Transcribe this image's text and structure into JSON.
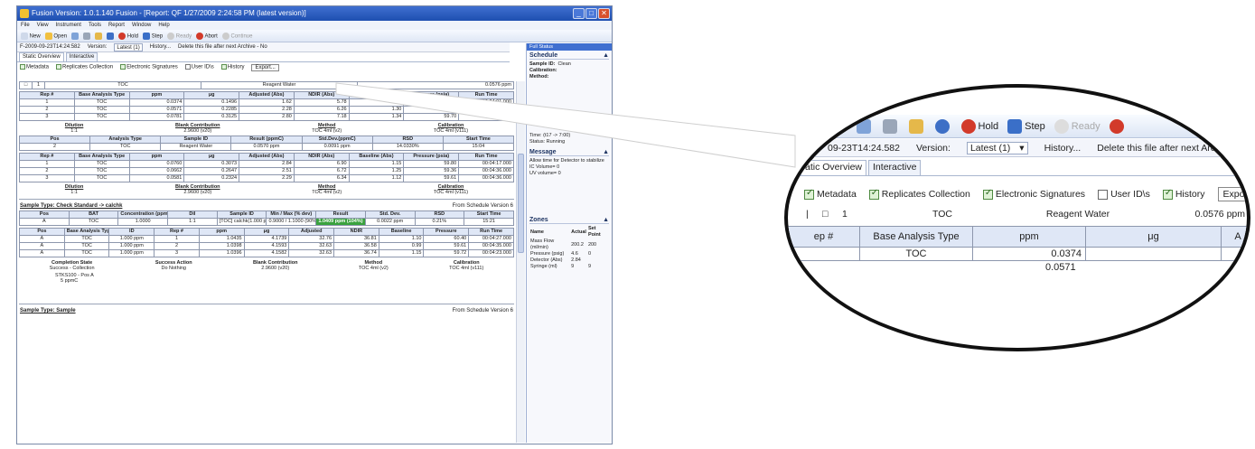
{
  "window": {
    "title": "Fusion Version: 1.0.1.140 Fusion - [Report: QF 1/27/2009 2:24:58 PM (latest version)]",
    "menu": [
      "File",
      "View",
      "Instrument",
      "Tools",
      "Report",
      "Window",
      "Help"
    ],
    "toolbar": {
      "new": "New",
      "open": "Open",
      "hold": "Hold",
      "step": "Step",
      "ready": "Ready",
      "abort": "Abort",
      "continue": "Continue"
    },
    "version_bar": {
      "report_id": "F-2009-09-23T14:24:582",
      "version_label": "Version:",
      "version_value": "Latest (1)",
      "history": "History...",
      "note": "Delete this file after next Archive - No"
    },
    "tabs": [
      "Static Overview",
      "Interactive"
    ],
    "options": [
      "Metadata",
      "Replicates Collection",
      "Electronic Signatures",
      "User ID\\s",
      "History"
    ],
    "export": "Export...",
    "top_row": {
      "num": "1",
      "type": "TOC",
      "sample": "Reagent Water",
      "result": "0.0576 ppm"
    }
  },
  "sample1": {
    "rep_headers": [
      "Rep #",
      "Base Analysis Type",
      "ppm",
      "μg",
      "Adjusted (Abs)",
      "NDIR (Abs)",
      "Baseline (Abs)",
      "Pressure (psia)",
      "Run Time"
    ],
    "rep_rows": [
      [
        "1",
        "TOC",
        "0.0374",
        "0.1496",
        "1.62",
        "5.78",
        "1.20",
        "59.20",
        "00:04:01.000"
      ],
      [
        "2",
        "TOC",
        "0.0571",
        "0.2285",
        "2.28",
        "6.26",
        "1.30",
        "59.64",
        "00:04:02.000"
      ],
      [
        "3",
        "TOC",
        "0.0781",
        "0.3125",
        "2.80",
        "7.18",
        "1.34",
        "59.70",
        "00:04:02.750"
      ]
    ],
    "stats": [
      {
        "label": "Dilution",
        "value": "1:1"
      },
      {
        "label": "Blank Contribution",
        "value": "2.9600 (v20)"
      },
      {
        "label": "Method",
        "value": "TOC 4ml (v2)"
      },
      {
        "label": "Calibration",
        "value": "TOC 4ml (v111)"
      }
    ]
  },
  "sample2": {
    "pos_headers": [
      "Pos",
      "Analysis Type",
      "Sample ID",
      "Result (ppmC)",
      "Std.Dev.(ppmC)",
      "RSD",
      "Start Time"
    ],
    "pos_row": [
      "2",
      "TOC",
      "Reagent Water",
      "0.0570 ppm",
      "0.0091 ppm",
      "14.0330%",
      "15:04"
    ],
    "rep_headers": [
      "Rep #",
      "Base Analysis Type",
      "ppm",
      "μg",
      "Adjusted (Abs)",
      "NDIR (Abs)",
      "Baseline (Abs)",
      "Pressure (psia)",
      "Run Time"
    ],
    "rep_rows": [
      [
        "1",
        "TOC",
        "0.0760",
        "0.3073",
        "2.84",
        "6.90",
        "1.15",
        "59.80",
        "00:04:17.000"
      ],
      [
        "2",
        "TOC",
        "0.0662",
        "0.2647",
        "2.51",
        "6.72",
        "1.25",
        "59.36",
        "00:04:36.000"
      ],
      [
        "3",
        "TOC",
        "0.0581",
        "0.2324",
        "2.29",
        "6.34",
        "1.12",
        "59.61",
        "00:04:36.000"
      ]
    ],
    "stats": [
      {
        "label": "Dilution",
        "value": "1:1"
      },
      {
        "label": "Blank Contribution",
        "value": "2.9600 (v20)"
      },
      {
        "label": "Method",
        "value": "TOC 4ml (v2)"
      },
      {
        "label": "Calibration",
        "value": "TOC 4ml (v111)"
      }
    ]
  },
  "check": {
    "sample_type": "Sample Type: Check Standard -> calchk",
    "schedule": "From Schedule Version 6",
    "headers": [
      "Pos",
      "BAT",
      "Concentration (ppm)",
      "Dil",
      "Sample ID",
      "Min / Max (% dev)",
      "Result",
      "Std. Dev.",
      "RSD",
      "Start Time"
    ],
    "row": [
      "A",
      "TOC",
      "1.0000",
      "1:1",
      "[TOC] calchk(1.000 ppm)",
      "0.9000 / 1.1000 (90%/110%)",
      "1.0409 ppm (104%)",
      "0.0022 ppm",
      "0.21%",
      "15:21"
    ],
    "rep_headers": [
      "Pos",
      "Base Analysis Type",
      "ID",
      "Rep #",
      "ppm",
      "μg",
      "Adjusted",
      "NDIR",
      "Baseline",
      "Pressure",
      "Run Time"
    ],
    "rep_rows": [
      [
        "A",
        "TOC",
        "1.000 ppm",
        "1",
        "1.0435",
        "4.1739",
        "32.76",
        "36.81",
        "1.10",
        "60.40",
        "00:04:27.000"
      ],
      [
        "A",
        "TOC",
        "1.000 ppm",
        "2",
        "1.0398",
        "4.1593",
        "32.63",
        "36.58",
        "0.99",
        "59.61",
        "00:04:35.000"
      ],
      [
        "A",
        "TOC",
        "1.000 ppm",
        "3",
        "1.0396",
        "4.1582",
        "32.63",
        "36.74",
        "1.15",
        "59.72",
        "00:04:23.000"
      ]
    ],
    "completion": [
      {
        "label": "Completion State",
        "value": "Success - Collection"
      },
      {
        "label": "Success Action",
        "value": "Do Nothing"
      },
      {
        "label": "Blank Contribution",
        "value": "2.9600 (v20)"
      },
      {
        "label": "Method",
        "value": "TOC 4ml (v2)"
      },
      {
        "label": "Calibration",
        "value": "TOC 4ml (v111)"
      }
    ],
    "status_line1": "STKS100 - Pos A",
    "status_line2": "5 ppmC",
    "footer_type": "Sample Type: Sample",
    "footer_schedule": "From Schedule Version 6"
  },
  "panel": {
    "head": "Full Status",
    "schedule_title": "Schedule",
    "schedule": [
      {
        "k": "Sample ID:",
        "v": "Clean"
      },
      {
        "k": "Calibration:",
        "v": ""
      },
      {
        "k": "Method:",
        "v": ""
      }
    ],
    "time": "Time: (t17 -> 7:00)",
    "status": "Status: Running",
    "message_title": "Message",
    "message": [
      "Allow time for Detector to stabilize",
      "IC Volume= 0",
      "UV volume= 0"
    ],
    "zones_title": "Zones",
    "zones_headers": [
      "Name",
      "Actual",
      "Set Point"
    ],
    "zones": [
      [
        "Mass Flow (ml/min)",
        "200.2",
        "200"
      ],
      [
        "Pressure (psig)",
        "4.6",
        "0"
      ],
      [
        "Detector (Abs)",
        "2.84",
        ""
      ],
      [
        "Syringe (ml)",
        "9",
        "9"
      ]
    ]
  },
  "zoom": {
    "hold": "Hold",
    "step": "Step",
    "ready": "Ready",
    "version_prefix": "09-23T14:24.582",
    "version_label": "Version:",
    "version_value": "Latest (1)",
    "history": "History...",
    "note": "Delete this file after next Archive",
    "tab1": "atic Overview",
    "tab2": "Interactive",
    "options": [
      "Metadata",
      "Replicates Collection",
      "Electronic Signatures",
      "User ID\\s",
      "History"
    ],
    "export": "Export...",
    "row_num": "1",
    "row_type": "TOC",
    "row_sample": "Reagent Water",
    "row_result": "0.0576 ppm",
    "hdr_rep": "ep #",
    "hdr_base": "Base Analysis Type",
    "hdr_ppm": "ppm",
    "hdr_ug": "μg",
    "hdr_adj": "A",
    "data_type": "TOC",
    "data_ppm": "0.0374",
    "data2_ppm": "0.0571"
  }
}
